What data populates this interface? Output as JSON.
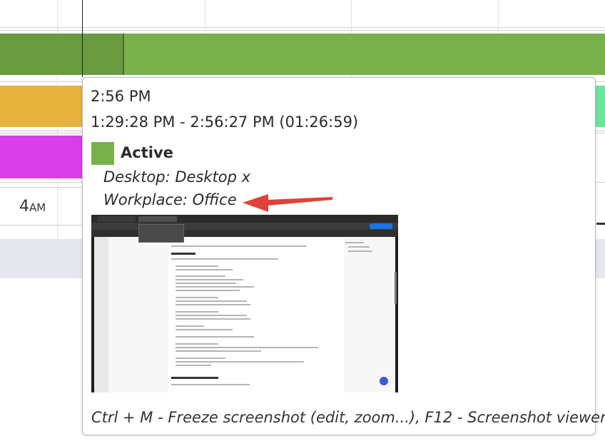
{
  "timeline": {
    "hour_label": "4",
    "hour_suffix": "AM",
    "colors": {
      "green": "#7ab04a",
      "yellow": "#e6b43e",
      "magenta": "#d93ee8",
      "mint": "#6be59b"
    }
  },
  "tooltip": {
    "time": "2:56 PM",
    "range": "1:29:28 PM - 2:56:27 PM (01:26:59)",
    "activity": "Active",
    "activity_color": "#7ab04a",
    "desktop": "Desktop: Desktop x",
    "workplace": "Workplace: Office",
    "footer": "Ctrl + M - Freeze screenshot (edit, zoom...), F12 - Screenshot viewer"
  },
  "annotation": {
    "arrow_color": "#e0413a"
  }
}
